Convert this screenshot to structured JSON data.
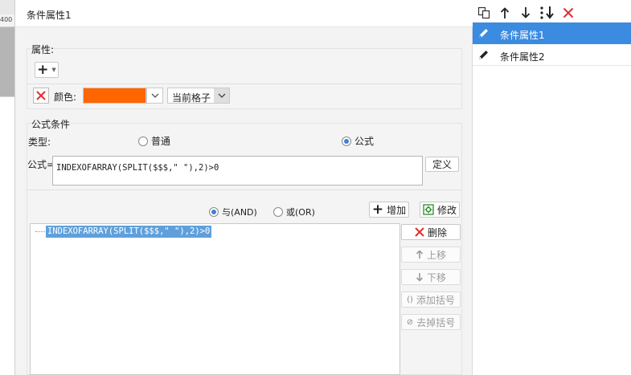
{
  "ruler": {
    "label": "400"
  },
  "dialog": {
    "title": "条件属性1"
  },
  "attributes": {
    "label": "属性:",
    "add_label": "+",
    "color_label": "颜色:",
    "color_value": "#ff6600",
    "scope_value": "当前格子"
  },
  "formula_cond": {
    "label": "公式条件",
    "type_label": "类型:",
    "option_normal": "普通",
    "option_formula": "公式",
    "formula_label": "公式=",
    "formula_value": "INDEXOFARRAY(SPLIT($$$,\" \"),2)>0",
    "define_button": "定义"
  },
  "logic": {
    "and_label": "与(AND)",
    "or_label": "或(OR)",
    "add_button": "增加",
    "modify_button": "修改"
  },
  "condition_list": {
    "items": [
      "INDEXOFARRAY(SPLIT($$$,\" \"),2)>0"
    ]
  },
  "side_buttons": {
    "delete": "删除",
    "move_up": "上移",
    "move_down": "下移",
    "add_bracket": "添加括号",
    "remove_bracket": "去掉括号"
  },
  "right_panel": {
    "items": [
      {
        "label": "条件属性1",
        "selected": true
      },
      {
        "label": "条件属性2",
        "selected": false
      }
    ]
  },
  "colors": {
    "accent": "#3b8be0",
    "selection": "#5fa0dc",
    "delete_red": "#e03030"
  }
}
